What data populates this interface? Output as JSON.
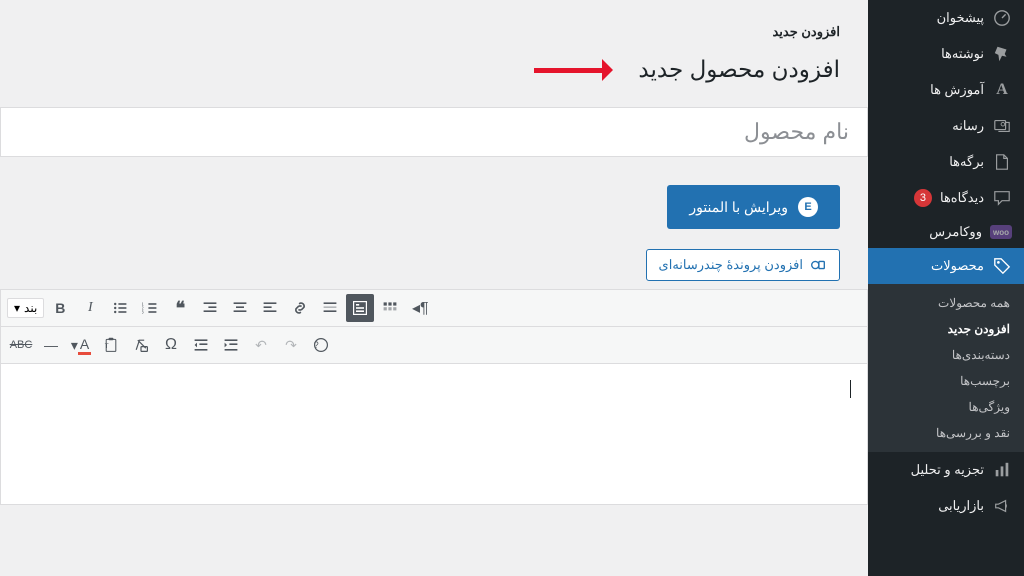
{
  "breadcrumb": "افزودن جدید",
  "page_title": "افزودن محصول جدید",
  "title_placeholder": "نام محصول",
  "elementor_label": "ویرایش با المنتور",
  "media_label": "افزودن پروندهٔ چندرسانه‌ای",
  "format_select": "بند",
  "sidebar": [
    {
      "icon": "dashboard",
      "label": "پیشخوان"
    },
    {
      "icon": "pin",
      "label": "نوشته‌ها"
    },
    {
      "icon": "A",
      "label": "آموزش ها",
      "textIcon": true
    },
    {
      "icon": "media",
      "label": "رسانه"
    },
    {
      "icon": "page",
      "label": "برگه‌ها"
    },
    {
      "icon": "comment",
      "label": "دیدگاه‌ها",
      "badge": "3"
    },
    {
      "icon": "woo",
      "label": "ووکامرس"
    },
    {
      "icon": "tag",
      "label": "محصولات",
      "active": true
    },
    {
      "icon": "chart",
      "label": "تجزیه و تحلیل"
    },
    {
      "icon": "megaphone",
      "label": "بازاریابی"
    }
  ],
  "submenu": [
    {
      "label": "همه محصولات"
    },
    {
      "label": "افزودن جدید",
      "current": true
    },
    {
      "label": "دسته‌بندی‌ها"
    },
    {
      "label": "برچسب‌ها"
    },
    {
      "label": "ویژگی‌ها"
    },
    {
      "label": "نقد و بررسی‌ها"
    }
  ],
  "toolbar_row1": [
    "B",
    "I",
    "list-ul",
    "list-ol",
    "quote",
    "align-right",
    "align-center",
    "align-left",
    "link",
    "more",
    "fullscreen",
    "toggle",
    "pilcrow"
  ],
  "toolbar_row2": [
    "strike",
    "hr",
    "color",
    "paste",
    "clear",
    "omega",
    "outdent",
    "indent",
    "undo",
    "redo",
    "help"
  ]
}
